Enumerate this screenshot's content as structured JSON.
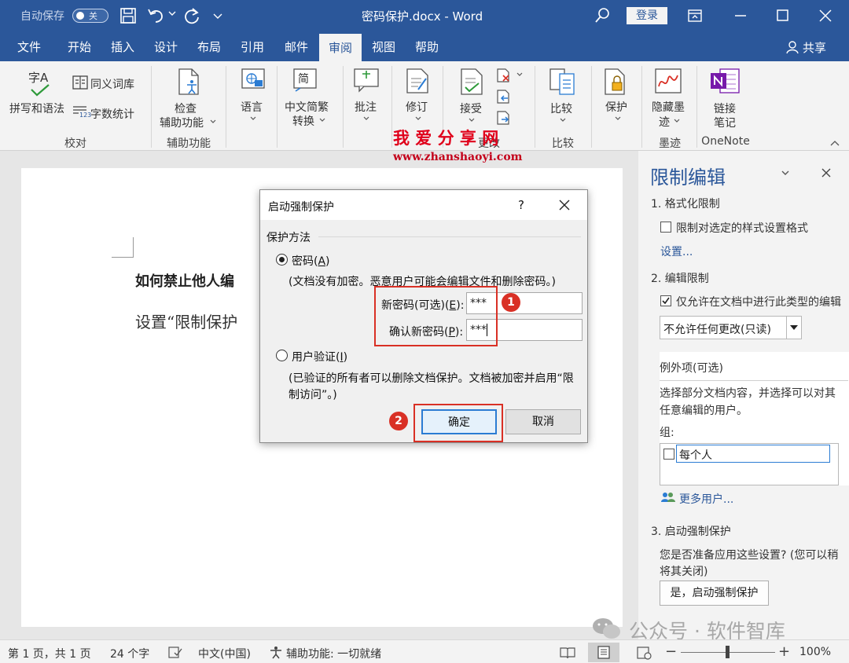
{
  "titlebar": {
    "autosave_label": "自动保存",
    "autosave_state": "关",
    "doc_title": "密码保护.docx - Word",
    "login": "登录"
  },
  "tabs": [
    {
      "label": "文件"
    },
    {
      "label": "开始"
    },
    {
      "label": "插入"
    },
    {
      "label": "设计"
    },
    {
      "label": "布局"
    },
    {
      "label": "引用"
    },
    {
      "label": "邮件"
    },
    {
      "label": "审阅"
    },
    {
      "label": "视图"
    },
    {
      "label": "帮助"
    }
  ],
  "share": "共享",
  "ribbon": {
    "spelling_icon_text": "字A",
    "spelling": "拼写和语法",
    "thesaurus": "同义词库",
    "wordcount": "字数统计",
    "wordcount_icon_text": "123",
    "group_proofing": "校对",
    "accessibility_l1": "检查",
    "accessibility_l2": "辅助功能",
    "group_accessibility": "辅助功能",
    "language": "语言",
    "chinese_icon_text": "简",
    "chinese_l1": "中文简繁",
    "chinese_l2": "转换",
    "comments": "批注",
    "track": "修订",
    "accept": "接受",
    "group_changes": "更改",
    "compare": "比较",
    "group_compare": "比较",
    "protect": "保护",
    "ink_l1": "隐藏墨",
    "ink_l2": "迹",
    "group_ink": "墨迹",
    "onenote_l1": "链接",
    "onenote_l2": "笔记",
    "group_onenote": "OneNote"
  },
  "watermark": {
    "main": "我 爱 分 享 网",
    "url": "www.zhanshaoyi.com"
  },
  "document": {
    "heading": "如何禁止他人编",
    "body": "设置“限制保护"
  },
  "dialog": {
    "title": "启动强制保护",
    "help": "?",
    "section": "保护方法",
    "password_label": "密码",
    "password_key": "A",
    "password_note": "(文档没有加密。恶意用户可能会编辑文件和删除密码。)",
    "new_pw_label": "新密码(可选)",
    "new_pw_key": "E",
    "new_pw_value": "***",
    "confirm_pw_label": "确认新密码",
    "confirm_pw_key": "P",
    "confirm_pw_value": "***",
    "user_auth_label": "用户验证",
    "user_auth_key": "I",
    "user_auth_note_l1": "(已验证的所有者可以删除文档保护。文档被加密并启用“限",
    "user_auth_note_l2": "制访问”。)",
    "ok": "确定",
    "cancel": "取消",
    "badge1": "1",
    "badge2": "2"
  },
  "panel": {
    "title": "限制编辑",
    "s1": "1. 格式化限制",
    "s1_check": "限制对选定的样式设置格式",
    "s1_link": "设置...",
    "s2": "2. 编辑限制",
    "s2_check": "仅允许在文档中进行此类型的编辑",
    "s2_select": "不允许任何更改(只读)",
    "exceptions": "例外项(可选)",
    "exceptions_desc_l1": "选择部分文档内容，并选择可以对其",
    "exceptions_desc_l2": "任意编辑的用户。",
    "groups": "组:",
    "everyone": "每个人",
    "more_users": "更多用户...",
    "s3": "3. 启动强制保护",
    "s3_desc_l1": "您是否准备应用这些设置? (您可以稍",
    "s3_desc_l2": "将其关闭)",
    "s3_button": "是，启动强制保护"
  },
  "status": {
    "page": "第 1 页，共 1 页",
    "words": "24 个字",
    "language": "中文(中国)",
    "accessibility": "辅助功能: 一切就绪",
    "zoom": "100%"
  },
  "wechat_watermark": "公众号 · 软件智库",
  "colors": {
    "accent": "#2b579a",
    "highlight": "#d93025"
  }
}
